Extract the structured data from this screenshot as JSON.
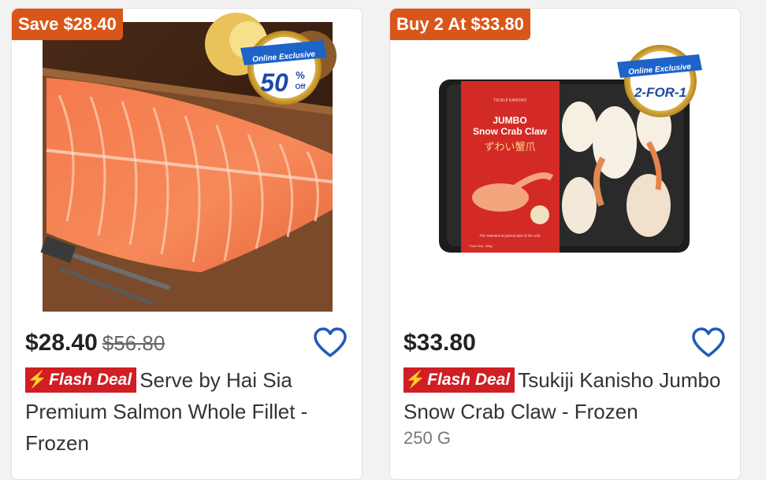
{
  "products": [
    {
      "promo_badge": "Save $28.40",
      "exclusive_badge": {
        "line1": "Online Exclusive",
        "line2": "50",
        "line3": "%",
        "line4": "Off"
      },
      "price": "$28.40",
      "original_price": "$56.80",
      "flash_label": "Flash Deal",
      "title": "Serve by Hai Sia Premium Salmon Whole Fillet - Frozen",
      "size": ""
    },
    {
      "promo_badge": "Buy 2 At $33.80",
      "exclusive_badge": {
        "line1": "Online Exclusive",
        "line2": "2-FOR-1"
      },
      "price": "$33.80",
      "original_price": "",
      "flash_label": "Flash Deal",
      "title": "Tsukiji Kanisho Jumbo Snow Crab Claw - Frozen",
      "size": "250 G",
      "package": {
        "brand": "TSUKIJI KANISHO",
        "name_line1": "JUMBO",
        "name_line2": "Snow Crab Claw",
        "jp": "ずわい蟹爪",
        "tagline": "The sweetest & juiciest part of the crab",
        "pack_size": "Pack Size: 250g"
      }
    }
  ],
  "colors": {
    "promo": "#d9561a",
    "flash": "#cf1e24",
    "heart": "#1f5bb5",
    "badge_blue": "#1e63c8",
    "badge_gold": "#d9a82a"
  },
  "icons": {
    "wishlist": "heart-outline-icon",
    "flash": "lightning-bolt-icon"
  }
}
